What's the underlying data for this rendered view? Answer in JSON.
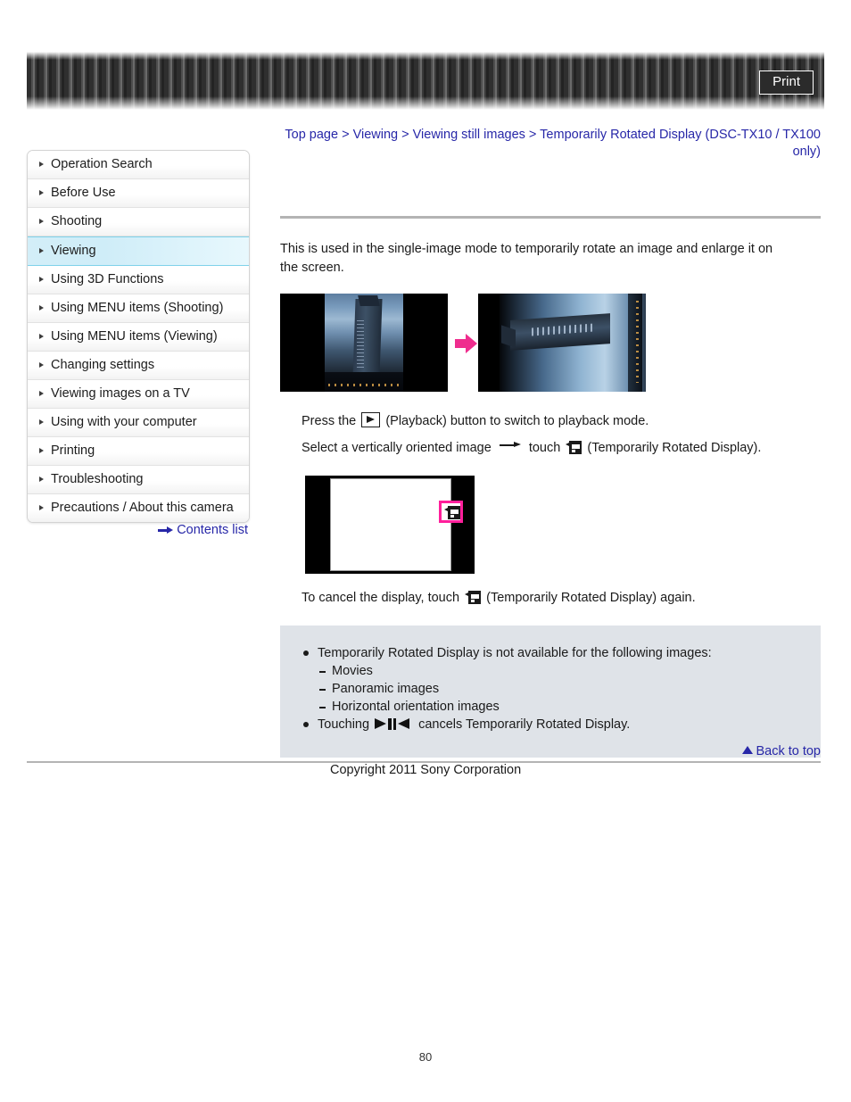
{
  "header": {
    "print_label": "Print"
  },
  "breadcrumb": {
    "items": [
      "Top page",
      "Viewing",
      "Viewing still images",
      "Temporarily Rotated Display (DSC-TX10 / TX100 only)"
    ],
    "separator": ">",
    "link_color": "#2727a8"
  },
  "sidebar": {
    "items": [
      {
        "label": "Operation Search",
        "selected": false
      },
      {
        "label": "Before Use",
        "selected": false
      },
      {
        "label": "Shooting",
        "selected": false
      },
      {
        "label": "Viewing",
        "selected": true
      },
      {
        "label": "Using 3D Functions",
        "selected": false
      },
      {
        "label": "Using MENU items (Shooting)",
        "selected": false
      },
      {
        "label": "Using MENU items (Viewing)",
        "selected": false
      },
      {
        "label": "Changing settings",
        "selected": false
      },
      {
        "label": "Viewing images on a TV",
        "selected": false
      },
      {
        "label": "Using with your computer",
        "selected": false
      },
      {
        "label": "Printing",
        "selected": false
      },
      {
        "label": "Troubleshooting",
        "selected": false
      },
      {
        "label": "Precautions / About this camera",
        "selected": false
      }
    ],
    "selected_color": "#cfedf8",
    "contents_list_label": "Contents list"
  },
  "main": {
    "intro": "This is used in the single-image mode to temporarily rotate an image and enlarge it on the screen.",
    "step1_before_icon": "Press the",
    "step1_after_icon": "(Playback) button to switch to playback mode.",
    "step2_before_arrow": "Select a vertically oriented image",
    "step2_after_arrow": "touch",
    "step2_tail": "(Temporarily Rotated Display).",
    "cancel_before_icon": "To cancel the display, touch",
    "cancel_after_icon": "(Temporarily Rotated Display) again.",
    "accent_pink": "#ef2d8e",
    "highlight_pink": "#ff1f9b"
  },
  "notes": {
    "background": "#dfe3e8",
    "items": [
      "Temporarily Rotated Display is not available for the following images:"
    ],
    "sub_items": [
      "Movies",
      "Panoramic images",
      "Horizontal orientation images"
    ],
    "touch_prefix": "Touching",
    "touch_suffix": "cancels Temporarily Rotated Display."
  },
  "footer": {
    "back_to_top": "Back to top",
    "copyright": "Copyright 2011 Sony Corporation",
    "page_number": "80"
  }
}
